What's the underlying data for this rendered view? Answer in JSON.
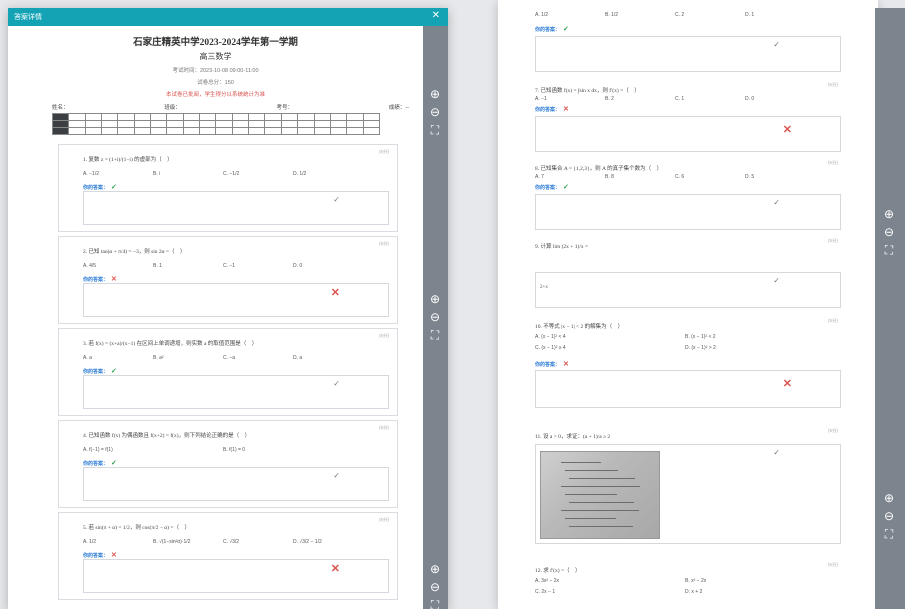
{
  "left_window": {
    "title": "答案详情",
    "close_icon": "✕",
    "rail_buttons": [
      "zoom-in",
      "zoom-out",
      "fit"
    ],
    "exam": {
      "title": "石家庄精英中学2023-2024学年第一学期",
      "subject": "高三数学",
      "time": "考试时间：2023-10-08 09:00-11:00",
      "total": "试卷总分：150",
      "notice": "本试卷已批阅，学生得分以系统统计为准",
      "name_label": "姓名：",
      "class_label": "班级：",
      "id_label": "考号：",
      "score_label": "成绩：",
      "score_value": "--"
    },
    "score_table_rows": 3,
    "score_table_cols": 20,
    "questions": [
      {
        "num": "1.",
        "text": "1. 复数 z = (1+i)/(1−i) 的虚部为（　）",
        "options": [
          "A. −1/2",
          "B. i",
          "C. −1/2",
          "D. 1/2"
        ],
        "answer": "你的答案：",
        "result": "ok"
      },
      {
        "num": "2.",
        "text": "2. 已知 tan(α + π/4) = −3，则 sin 2α =（　）",
        "options": [
          "A. 4/5",
          "B. 1",
          "C. −1",
          "D. 0"
        ],
        "answer": "你的答案：",
        "result": "x"
      },
      {
        "num": "3.",
        "text": "3. 若 f(x) = (x+a)/(x−1) 在区间上单调递增，则实数 a 的取值范围是（　）",
        "options": [
          "A. a",
          "B. a²",
          "C. −a",
          "D. a"
        ],
        "answer": "你的答案：",
        "result": "ok"
      },
      {
        "num": "4.",
        "text": "4. 已知函数 f(x) 为偶函数且 f(x+2) = f(x)，则下列结论正确的是（　）",
        "options": [
          "A. f(−1) = f(1)",
          "",
          "B. f(1) = 0",
          ""
        ],
        "answer": "你的答案：",
        "result": "ok"
      },
      {
        "num": "5.",
        "text": "5. 若 sin(π + α) = 1/2，则 cos(π/2 − α) =（　）",
        "options": [
          "A. 1/2",
          "B. √(1−sin²α)·1/2",
          "C. √3/2",
          "D. √3/2 − 1/2"
        ],
        "answer": "你的答案：",
        "result": "x"
      }
    ]
  },
  "right_window": {
    "rail_buttons": [
      "zoom-in",
      "zoom-out",
      "fit"
    ],
    "top_options": [
      "A. 1/2",
      "B. 1/2",
      "C. 2",
      "D. 1"
    ],
    "top_answer": "你的答案：",
    "questions": [
      {
        "text": "7. 已知函数 f(x) = ∫sin x dx，则 f′(x) =（　）",
        "options": [
          "A. −1",
          "B. 2",
          "C. 1",
          "D. 0"
        ],
        "answer": "你的答案：",
        "result": "x"
      },
      {
        "text": "8. 已知集合 A = {1,2,3}，则 A 的真子集个数为（　）",
        "options": [
          "A. 7",
          "B. 8",
          "C. 6",
          "D. 5"
        ],
        "answer": "你的答案：",
        "result": "ok"
      },
      {
        "text": "9. 计算 lim (2x + 1)/x =",
        "written": "2+x",
        "result": "ok"
      },
      {
        "text": "10. 不等式 |x − 1| < 2 的解集为（　）",
        "options2": [
          [
            "A. (x − 1)² < 4",
            "B. (x − 1)² < 2"
          ],
          [
            "C. (x − 1)² ≥ 4",
            "D. (x − 1)² > 2"
          ]
        ],
        "answer": "你的答案：",
        "result": "x"
      },
      {
        "text": "11. 设 a > 0，求证：(a + 1)/a ≥ 2",
        "photo": true,
        "result": "ok"
      },
      {
        "text": "12. 求 f′(x) =（　）",
        "options2": [
          [
            "A. 3x² − 2x",
            "B. x² − 2x"
          ],
          [
            "C. 2x − 1",
            "D. x + 2"
          ]
        ]
      }
    ]
  }
}
